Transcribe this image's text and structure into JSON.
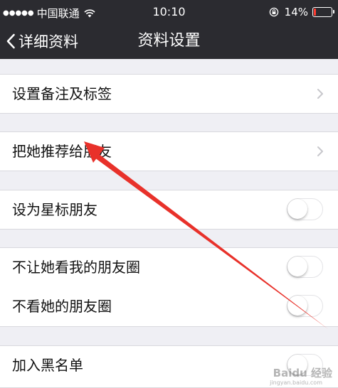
{
  "status_bar": {
    "signal_dots": "●●●●●",
    "carrier": "中国联通",
    "wifi_icon": "wifi-icon",
    "time": "10:10",
    "battery_percent": "14%",
    "battery_level": 0.14,
    "battery_color": "#ff3b30"
  },
  "nav": {
    "back_label": "详细资料",
    "title": "资料设置"
  },
  "settings": {
    "remark_label": "设置备注及标签",
    "recommend_label": "把她推荐给朋友",
    "star_label": "设为星标朋友",
    "star_on": false,
    "hide_moments_label": "不让她看我的朋友圈",
    "hide_moments_on": false,
    "not_view_label": "不看她的朋友圈",
    "not_view_on": false,
    "blacklist_label": "加入黑名单",
    "blacklist_on": false
  },
  "annotation": {
    "arrow_color": "#e8312a",
    "watermark_text": "Baidu 经验",
    "watermark_url": "jingyan.baidu.com"
  }
}
